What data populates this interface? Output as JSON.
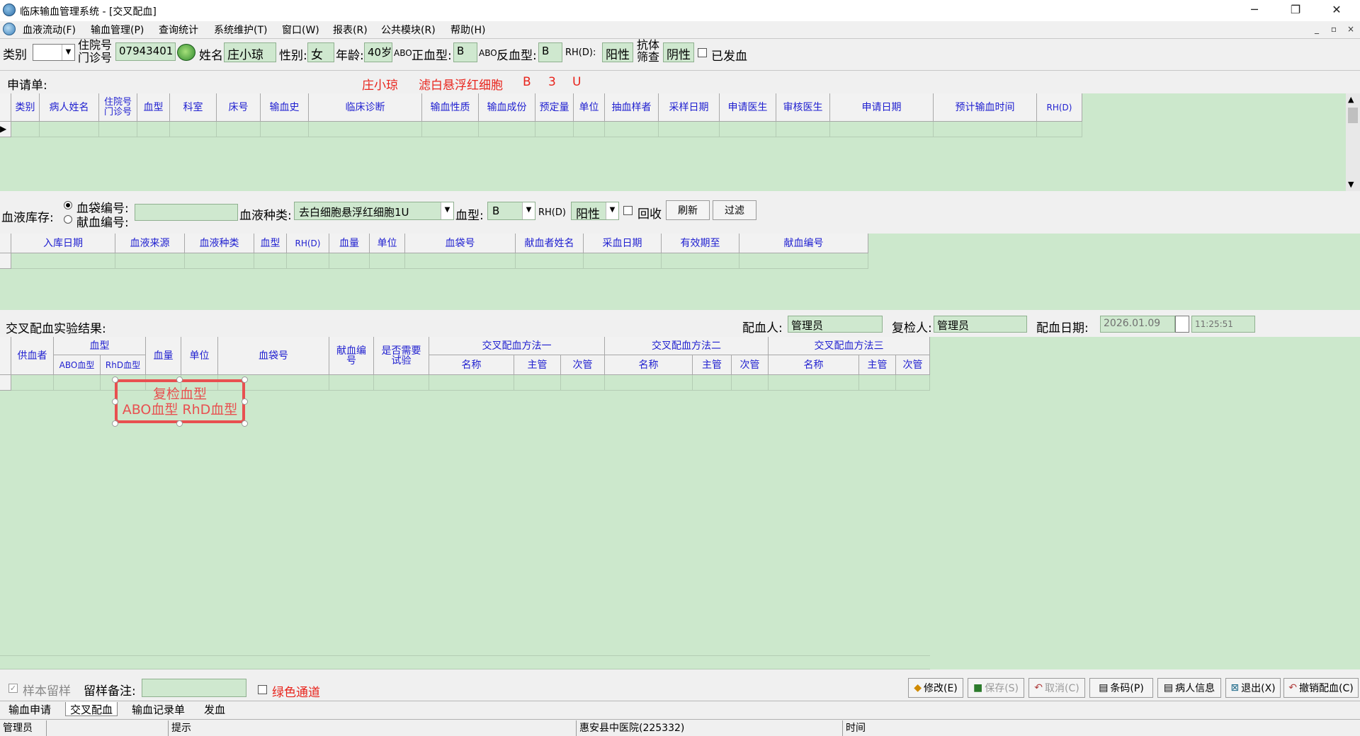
{
  "window": {
    "title": "临床输血管理系统 - [交叉配血]",
    "min": "─",
    "max": "❐",
    "close": "✕",
    "mdi_min": "_",
    "mdi_max": "▫",
    "mdi_close": "×"
  },
  "menu": [
    "血液流动(F)",
    "输血管理(P)",
    "查询统计",
    "系统维护(T)",
    "窗口(W)",
    "报表(R)",
    "公共模块(R)",
    "帮助(H)"
  ],
  "patient": {
    "category_label": "类别",
    "category_value": "",
    "hosp_no_label_1": "住院号",
    "hosp_no_label_2": "门诊号",
    "hosp_no": "07943401",
    "name_label": "姓名",
    "name": "庄小琼",
    "sex_label": "性别:",
    "sex": "女",
    "age_label": "年龄:",
    "age": "40岁",
    "abo_pos_prefix": "ABO",
    "abo_pos_label": "正血型:",
    "abo_pos": "B",
    "abo_rev_prefix": "ABO",
    "abo_rev_label": "反血型:",
    "abo_rev": "B",
    "rhd_label": "RH(D):",
    "rhd": "阳性",
    "antibody_label_1": "抗体",
    "antibody_label_2": "筛查",
    "antibody": "阴性",
    "issued_label": "已发血"
  },
  "request": {
    "label": "申请单:",
    "summary_name": "庄小琼",
    "summary_product": "滤白悬浮红细胞",
    "summary_abo": "B",
    "summary_qty": "3",
    "summary_unit": "U",
    "columns": [
      "类别",
      "病人姓名",
      "住院号|门诊号",
      "血型",
      "科室",
      "床号",
      "输血史",
      "临床诊断",
      "输血性质",
      "输血成份",
      "预定量",
      "单位",
      "抽血样者",
      "采样日期",
      "申请医生",
      "审核医生",
      "申请日期",
      "预计输血时间",
      "RH(D)"
    ]
  },
  "stock": {
    "label": "血液库存:",
    "opt_bag": "血袋编号:",
    "opt_donor": "献血编号:",
    "type_label": "血液种类:",
    "type_value": "去白细胞悬浮红细胞1U",
    "abo_label": "血型:",
    "abo_value": "B",
    "rhd_label": "RH(D)",
    "rhd_value": "阳性",
    "recycle_label": "回收",
    "refresh": "刷新",
    "filter": "过滤",
    "columns": [
      "入库日期",
      "血液来源",
      "血液种类",
      "血型",
      "RH(D)",
      "血量",
      "单位",
      "血袋号",
      "献血者姓名",
      "采血日期",
      "有效期至",
      "献血编号"
    ]
  },
  "crossmatch": {
    "label": "交叉配血实验结果:",
    "matcher_label": "配血人:",
    "matcher": "管理员",
    "checker_label": "复检人:",
    "checker": "管理员",
    "date_label": "配血日期:",
    "date": "2026.01.09",
    "time": "11:25:51",
    "col_donor": "供血者",
    "col_bloodtype": "血型",
    "col_abo": "ABO血型",
    "col_rhd": "RhD血型",
    "col_volume": "血量",
    "col_unit": "单位",
    "col_bagno": "血袋号",
    "col_donorno": "献血编号",
    "col_retest": "是否需要试验",
    "method1": "交叉配血方法一",
    "method2": "交叉配血方法二",
    "method3": "交叉配血方法三",
    "sub_name": "名称",
    "sub_main": "主管",
    "sub_minor": "次管",
    "annotation_line1": "复检血型",
    "annotation_line2": "ABO血型 RhD血型"
  },
  "bottom": {
    "sample_keep": "样本留样",
    "sample_note_label": "留样备注:",
    "green_channel": "绿色通道",
    "buttons": [
      "修改(E)",
      "保存(S)",
      "取消(C)",
      "条码(P)",
      "病人信息",
      "退出(X)",
      "撤销配血(C)"
    ]
  },
  "tabs": [
    "输血申请",
    "交叉配血",
    "输血记录单",
    "发血"
  ],
  "status": {
    "user": "管理员",
    "hint": "提示",
    "hospital": "惠安县中医院(225332)",
    "time_label": "时间"
  }
}
